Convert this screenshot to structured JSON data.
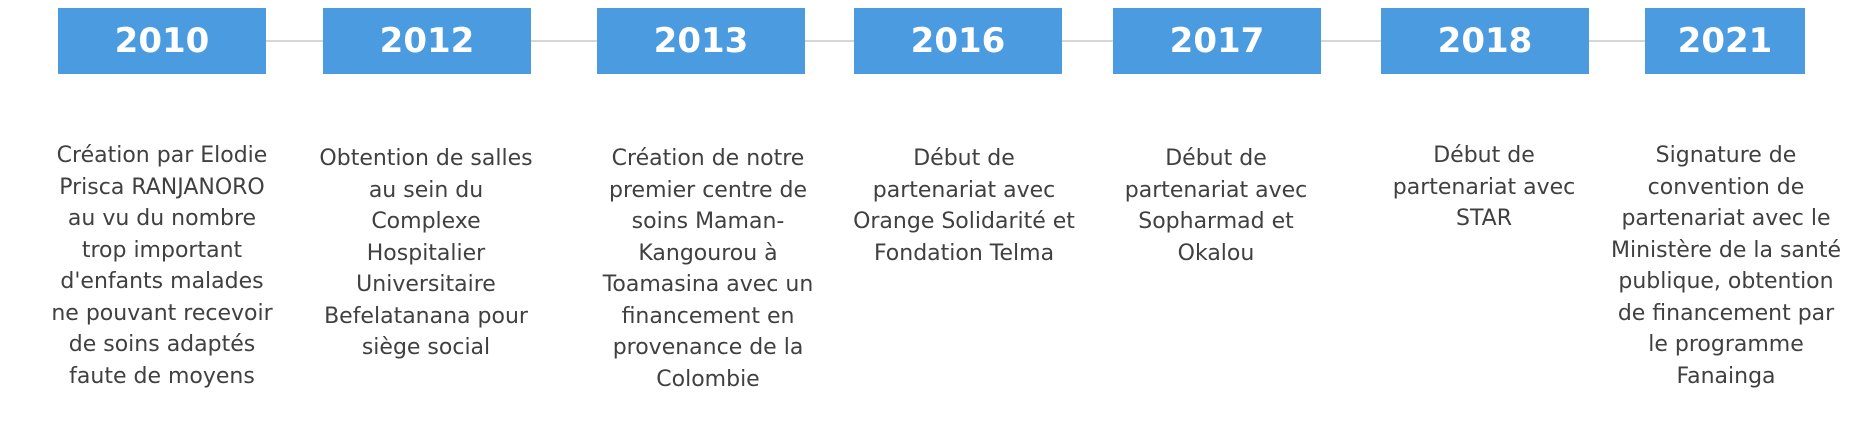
{
  "colors": {
    "box": "#4a9be0",
    "box_text": "#ffffff",
    "connector": "#d6d6d6",
    "description_text": "#404040"
  },
  "milestones": [
    {
      "year": "2010",
      "lines": [
        "Création par  Elodie",
        "Prisca RANJANORO",
        "au vu du nombre",
        "trop important",
        "d'enfants malades",
        "ne pouvant recevoir",
        "de soins adaptés",
        "faute de moyens"
      ]
    },
    {
      "year": "2012",
      "lines": [
        "Obtention de salles",
        "au sein du",
        "Complexe",
        "Hospitalier",
        "Universitaire",
        "Befelatanana pour",
        "siège social"
      ]
    },
    {
      "year": "2013",
      "lines": [
        "Création de notre",
        "premier centre de",
        "soins Maman-",
        "Kangourou à",
        "Toamasina avec un",
        "financement en",
        "provenance de la",
        "Colombie"
      ]
    },
    {
      "year": "2016",
      "lines": [
        "Début de",
        "partenariat avec",
        "Orange Solidarité et",
        "Fondation Telma"
      ]
    },
    {
      "year": "2017",
      "lines": [
        "Début de",
        "partenariat avec",
        "Sopharmad et",
        "Okalou"
      ]
    },
    {
      "year": "2018",
      "lines": [
        "Début de",
        "partenariat avec",
        "STAR"
      ]
    },
    {
      "year": "2021",
      "lines": [
        "Signature de",
        "convention de",
        "partenariat avec le",
        "Ministère de la santé",
        "publique, obtention",
        "de financement par",
        "le programme",
        "Fanainga"
      ]
    }
  ]
}
